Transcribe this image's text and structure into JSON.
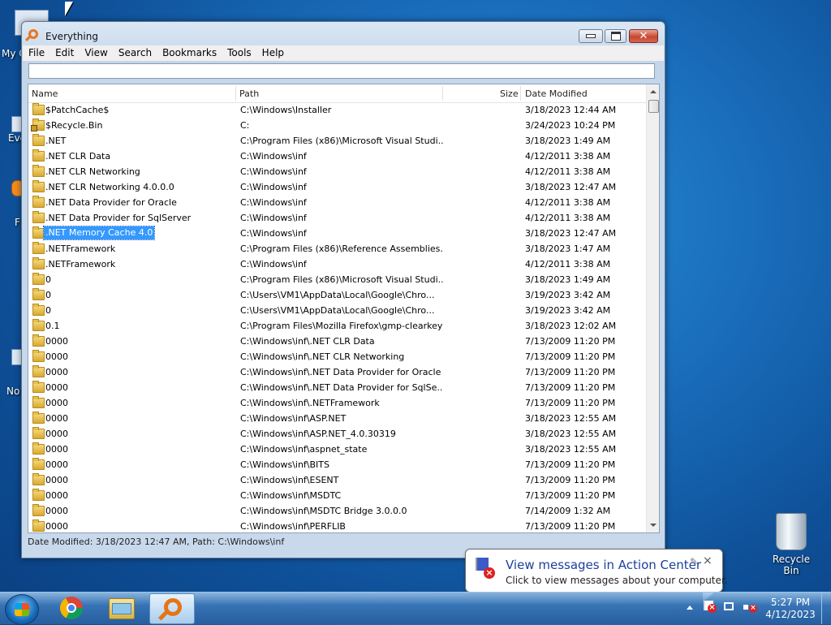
{
  "desktop": {
    "partial_labels": [
      "My C",
      "Eve",
      "F",
      "No"
    ],
    "recycle_bin_label": "Recycle Bin"
  },
  "window": {
    "title": "Everything",
    "menus": [
      "File",
      "Edit",
      "View",
      "Search",
      "Bookmarks",
      "Tools",
      "Help"
    ],
    "search_value": "",
    "columns": {
      "name": "Name",
      "path": "Path",
      "size": "Size",
      "date": "Date Modified"
    },
    "rows": [
      {
        "name": "$PatchCache$",
        "path": "C:\\Windows\\Installer",
        "date": "3/18/2023 12:44 AM"
      },
      {
        "name": "$Recycle.Bin",
        "path": "C:",
        "date": "3/24/2023 10:24 PM",
        "locked": true
      },
      {
        "name": ".NET",
        "path": "C:\\Program Files (x86)\\Microsoft Visual Studi...",
        "date": "3/18/2023 1:49 AM"
      },
      {
        "name": ".NET CLR Data",
        "path": "C:\\Windows\\inf",
        "date": "4/12/2011 3:38 AM"
      },
      {
        "name": ".NET CLR Networking",
        "path": "C:\\Windows\\inf",
        "date": "4/12/2011 3:38 AM"
      },
      {
        "name": ".NET CLR Networking 4.0.0.0",
        "path": "C:\\Windows\\inf",
        "date": "3/18/2023 12:47 AM"
      },
      {
        "name": ".NET Data Provider for Oracle",
        "path": "C:\\Windows\\inf",
        "date": "4/12/2011 3:38 AM"
      },
      {
        "name": ".NET Data Provider for SqlServer",
        "path": "C:\\Windows\\inf",
        "date": "4/12/2011 3:38 AM"
      },
      {
        "name": ".NET Memory Cache 4.0",
        "path": "C:\\Windows\\inf",
        "date": "3/18/2023 12:47 AM",
        "selected": true
      },
      {
        "name": ".NETFramework",
        "path": "C:\\Program Files (x86)\\Reference Assemblies...",
        "date": "3/18/2023 1:47 AM"
      },
      {
        "name": ".NETFramework",
        "path": "C:\\Windows\\inf",
        "date": "4/12/2011 3:38 AM"
      },
      {
        "name": "0",
        "path": "C:\\Program Files (x86)\\Microsoft Visual Studi...",
        "date": "3/18/2023 1:49 AM"
      },
      {
        "name": "0",
        "path": "C:\\Users\\VM1\\AppData\\Local\\Google\\Chro...",
        "date": "3/19/2023 3:42 AM"
      },
      {
        "name": "0",
        "path": "C:\\Users\\VM1\\AppData\\Local\\Google\\Chro...",
        "date": "3/19/2023 3:42 AM"
      },
      {
        "name": "0.1",
        "path": "C:\\Program Files\\Mozilla Firefox\\gmp-clearkey",
        "date": "3/18/2023 12:02 AM"
      },
      {
        "name": "0000",
        "path": "C:\\Windows\\inf\\.NET CLR Data",
        "date": "7/13/2009 11:20 PM"
      },
      {
        "name": "0000",
        "path": "C:\\Windows\\inf\\.NET CLR Networking",
        "date": "7/13/2009 11:20 PM"
      },
      {
        "name": "0000",
        "path": "C:\\Windows\\inf\\.NET Data Provider for Oracle",
        "date": "7/13/2009 11:20 PM"
      },
      {
        "name": "0000",
        "path": "C:\\Windows\\inf\\.NET Data Provider for SqlSe...",
        "date": "7/13/2009 11:20 PM"
      },
      {
        "name": "0000",
        "path": "C:\\Windows\\inf\\.NETFramework",
        "date": "7/13/2009 11:20 PM"
      },
      {
        "name": "0000",
        "path": "C:\\Windows\\inf\\ASP.NET",
        "date": "3/18/2023 12:55 AM"
      },
      {
        "name": "0000",
        "path": "C:\\Windows\\inf\\ASP.NET_4.0.30319",
        "date": "3/18/2023 12:55 AM"
      },
      {
        "name": "0000",
        "path": "C:\\Windows\\inf\\aspnet_state",
        "date": "3/18/2023 12:55 AM"
      },
      {
        "name": "0000",
        "path": "C:\\Windows\\inf\\BITS",
        "date": "7/13/2009 11:20 PM"
      },
      {
        "name": "0000",
        "path": "C:\\Windows\\inf\\ESENT",
        "date": "7/13/2009 11:20 PM"
      },
      {
        "name": "0000",
        "path": "C:\\Windows\\inf\\MSDTC",
        "date": "7/13/2009 11:20 PM"
      },
      {
        "name": "0000",
        "path": "C:\\Windows\\inf\\MSDTC Bridge 3.0.0.0",
        "date": "7/14/2009 1:32 AM"
      },
      {
        "name": "0000",
        "path": "C:\\Windows\\inf\\PERFLIB",
        "date": "7/13/2009 11:20 PM"
      }
    ],
    "status": "Date Modified: 3/18/2023 12:47 AM, Path: C:\\Windows\\inf"
  },
  "notification": {
    "title": "View messages in Action Center",
    "text": "Click to view messages about your computer.",
    "close": "×"
  },
  "taskbar": {
    "time": "5:27 PM",
    "date": "4/12/2023"
  }
}
